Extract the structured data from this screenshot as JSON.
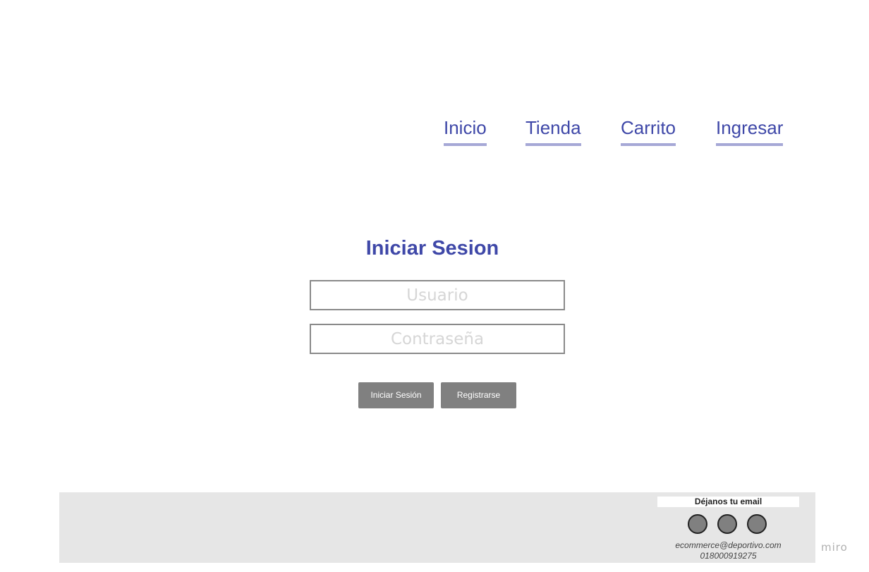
{
  "nav": {
    "items": [
      {
        "label": "Inicio"
      },
      {
        "label": "Tienda"
      },
      {
        "label": "Carrito"
      },
      {
        "label": "Ingresar"
      }
    ],
    "link_color": "#3f48a8",
    "underline_color": "#a6a8d6"
  },
  "login": {
    "title": "Iniciar Sesion",
    "username_placeholder": "Usuario",
    "password_placeholder": "Contraseña",
    "login_button": "Iniciar Sesión",
    "register_button": "Registrarse",
    "button_color": "#808080"
  },
  "footer": {
    "email_prompt": "Déjanos tu email",
    "social_icons": [
      "social-icon",
      "social-icon",
      "social-icon"
    ],
    "contact_email": "ecommerce@deportivo.com",
    "contact_phone": "018000919275",
    "background_color": "#e6e6e6"
  },
  "watermark": {
    "text": "miro"
  }
}
